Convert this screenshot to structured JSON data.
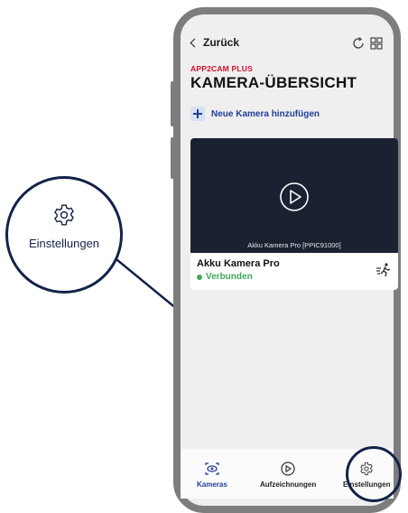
{
  "topbar": {
    "back_label": "Zurück",
    "icons": [
      "chevron-left-icon",
      "refresh-icon",
      "grid-icon"
    ]
  },
  "header": {
    "brand": "APP2CAM PLUS",
    "title": "KAMERA-ÜBERSICHT"
  },
  "add_camera": {
    "label": "Neue Kamera hinzufügen",
    "icon": "plus-icon"
  },
  "camera_card": {
    "video_caption": "Akku Kamera Pro [PPIC91000]",
    "name": "Akku Kamera Pro",
    "status": "Verbunden",
    "status_color": "#3fa85a",
    "icons": [
      "play-icon",
      "motion-detection-icon"
    ]
  },
  "bottom_nav": {
    "items": [
      {
        "label": "Kameras",
        "icon": "camera-eye-icon",
        "active": true
      },
      {
        "label": "Aufzeichnungen",
        "icon": "play-circle-icon",
        "active": false
      },
      {
        "label": "Einstellungen",
        "icon": "gear-icon",
        "active": false
      }
    ]
  },
  "callout": {
    "label": "Einstellungen",
    "icon": "gear-icon"
  },
  "colors": {
    "accent_blue": "#1f3f99",
    "brand_red": "#d3102c",
    "callout_navy": "#14224a",
    "video_bg": "#1a2232"
  }
}
